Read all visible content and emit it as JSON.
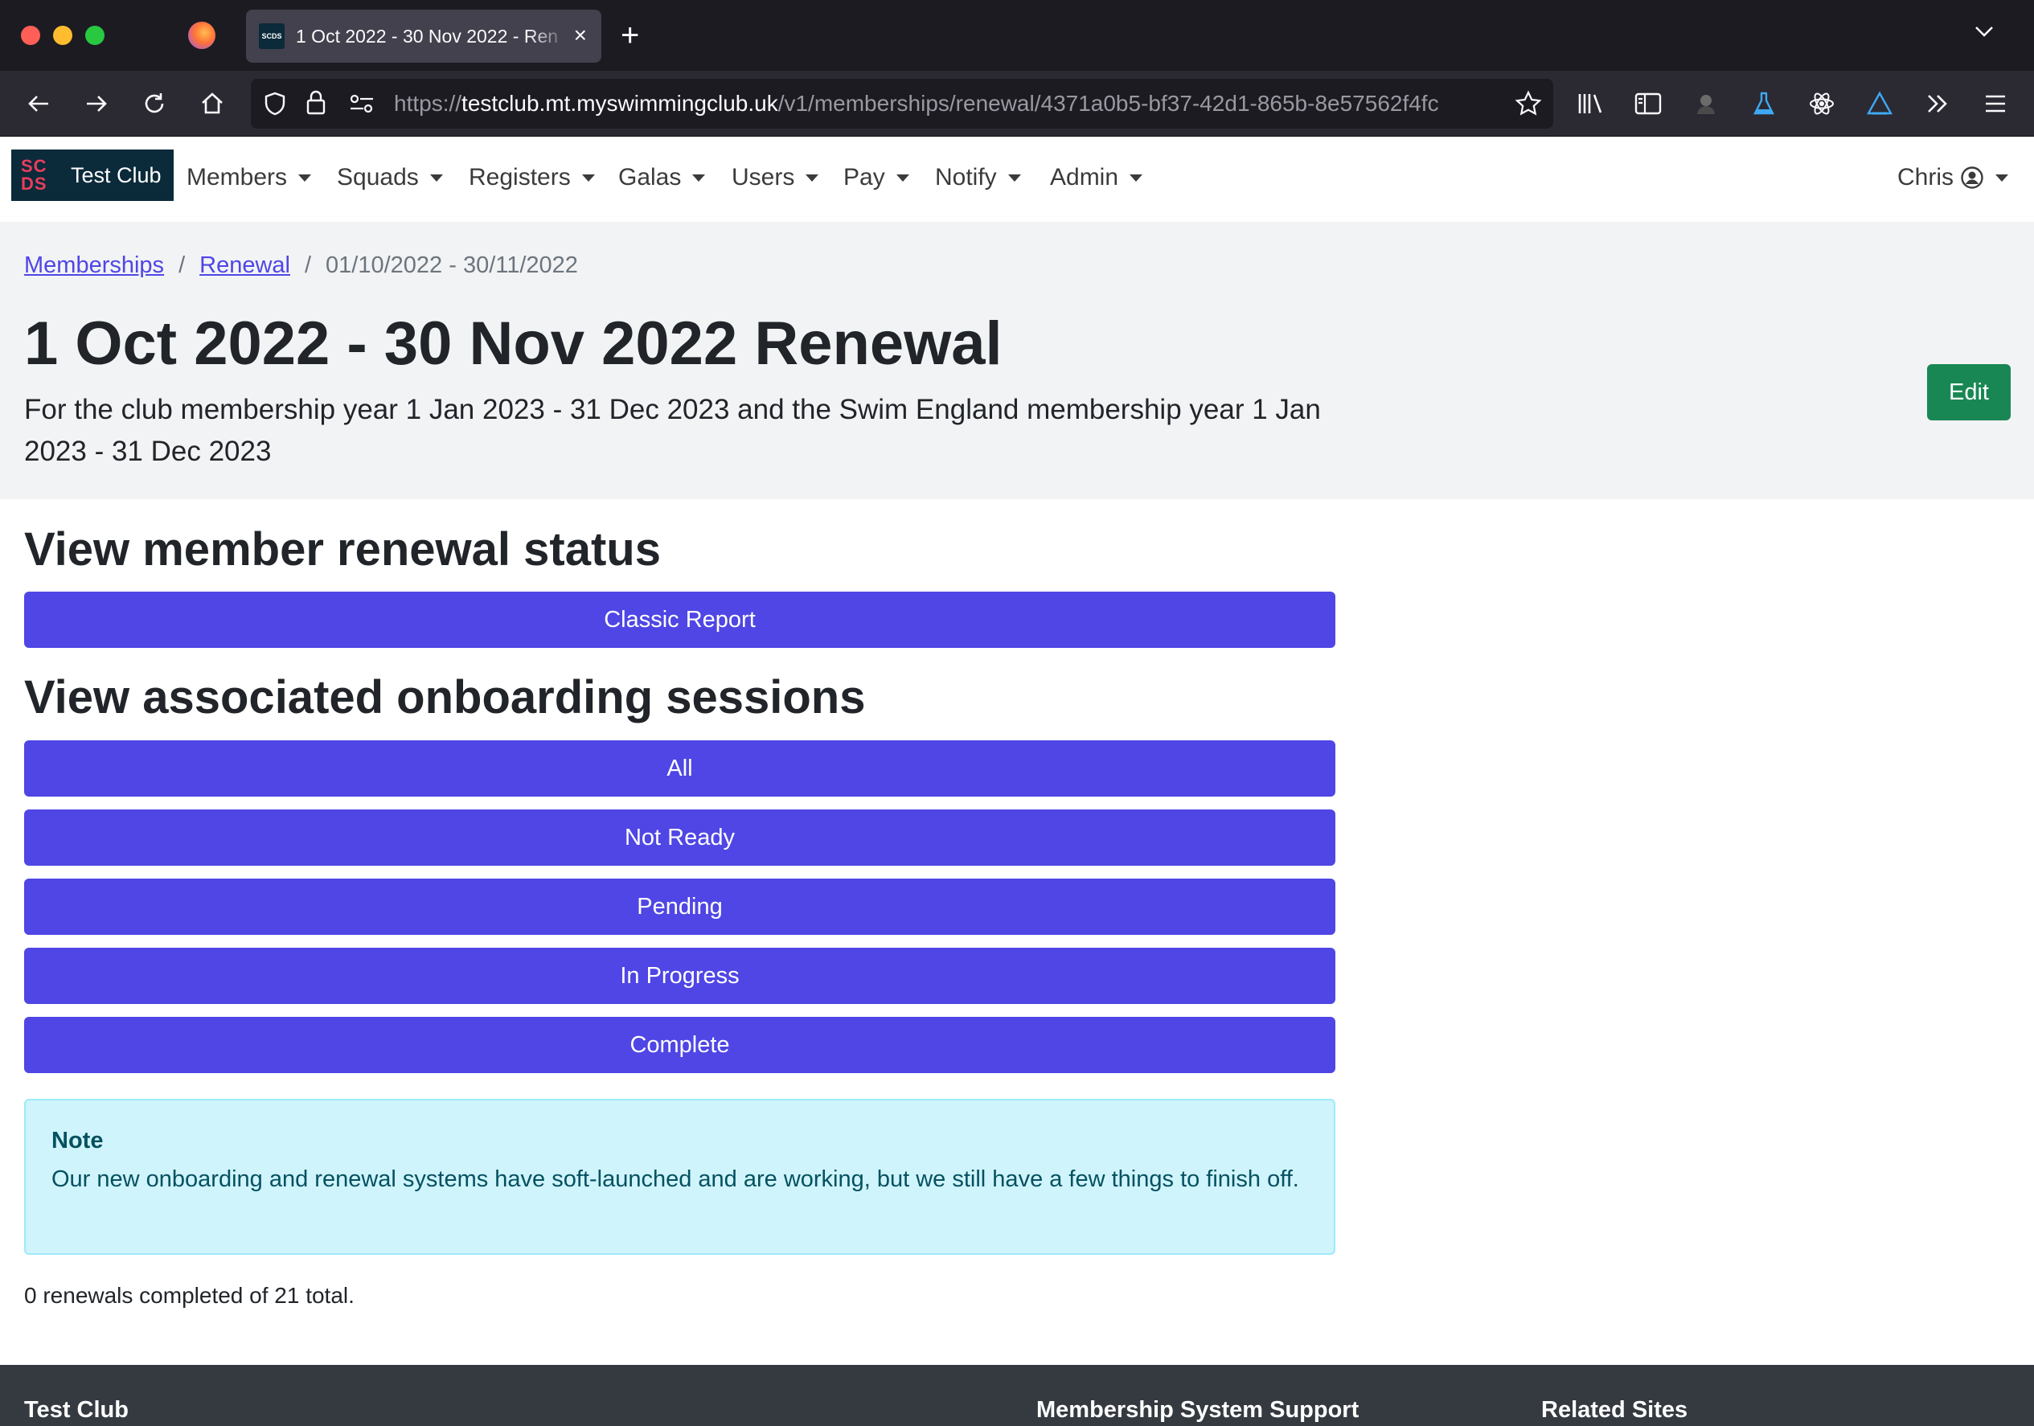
{
  "browser": {
    "tab_title": "1 Oct 2022 - 30 Nov 2022 - Ren",
    "favicon_text": "SCDS",
    "url_prefix": "https://",
    "url_host": "testclub.mt.myswimmingclub.uk",
    "url_path": "/v1/memberships/renewal/4371a0b5-bf37-42d1-865b-8e57562f4fc",
    "traffic_colors": [
      "#ff5f57",
      "#febc2e",
      "#28c840"
    ]
  },
  "nav": {
    "brand_mark": "SC DS",
    "brand_name": "Test Club",
    "items": [
      "Members",
      "Squads",
      "Registers",
      "Galas",
      "Users",
      "Pay",
      "Notify",
      "Admin"
    ],
    "user": "Chris"
  },
  "header": {
    "breadcrumb": [
      "Memberships",
      "Renewal",
      "01/10/2022 - 30/11/2022"
    ],
    "title": "1 Oct 2022 - 30 Nov 2022 Renewal",
    "subtitle": "For the club membership year 1 Jan 2023 - 31 Dec 2023 and the Swim England membership year 1 Jan 2023 - 31 Dec 2023",
    "edit_label": "Edit"
  },
  "status": {
    "title": "View member renewal status",
    "classic_report_label": "Classic Report"
  },
  "onboarding": {
    "title": "View associated onboarding sessions",
    "buttons": [
      "All",
      "Not Ready",
      "Pending",
      "In Progress",
      "Complete"
    ]
  },
  "note": {
    "title": "Note",
    "text": "Our new onboarding and renewal systems have soft-launched and are working, but we still have a few things to finish off."
  },
  "summary": "0 renewals completed of 21 total.",
  "footer": {
    "col1": "Test Club",
    "col2": "Membership System Support",
    "col3": "Related Sites"
  },
  "colors": {
    "primary": "#4f46e5",
    "success": "#198754",
    "info_bg": "#cff4fc",
    "header_bg": "#f2f3f5",
    "footer_bg": "#343a40",
    "brand_bg": "#0b2a3a"
  }
}
